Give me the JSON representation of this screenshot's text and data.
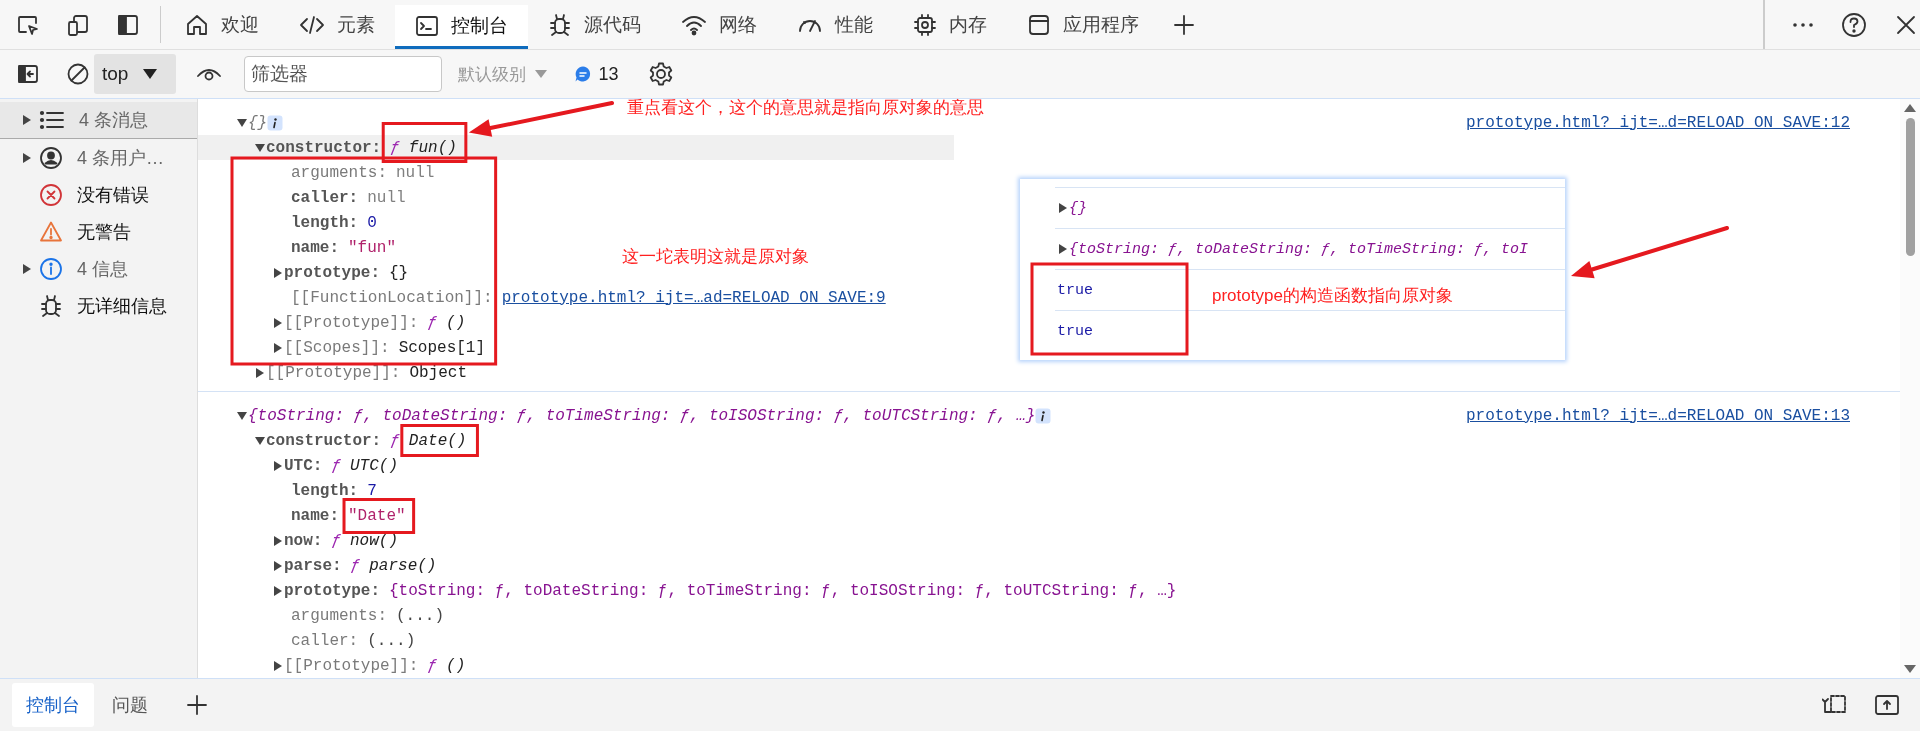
{
  "tabs": [
    {
      "label": "欢迎",
      "selected": false
    },
    {
      "label": "元素",
      "selected": false
    },
    {
      "label": "控制台",
      "selected": true
    },
    {
      "label": "源代码",
      "selected": false
    },
    {
      "label": "网络",
      "selected": false
    },
    {
      "label": "性能",
      "selected": false
    },
    {
      "label": "内存",
      "selected": false
    },
    {
      "label": "应用程序",
      "selected": false
    }
  ],
  "toolbar": {
    "context": "top",
    "filter": {
      "placeholder": "筛选器"
    },
    "levels": "默认级别",
    "message_count": "13"
  },
  "sidebar": {
    "items": [
      {
        "label": "4 条消息",
        "expandable": true,
        "muted": true,
        "selected": true
      },
      {
        "label": "4 条用户…",
        "expandable": true,
        "muted": true,
        "selected": false
      },
      {
        "label": "没有错误",
        "expandable": false,
        "muted": false,
        "selected": false
      },
      {
        "label": "无警告",
        "expandable": false,
        "muted": false,
        "selected": false
      },
      {
        "label": "4 信息",
        "expandable": true,
        "muted": true,
        "selected": false
      },
      {
        "label": "无详细信息",
        "expandable": false,
        "muted": false,
        "selected": false
      }
    ]
  },
  "console": {
    "messages": [
      {
        "summary": "{}",
        "expanded": true,
        "source": "prototype.html?_ijt=…d=RELOAD_ON_SAVE:12",
        "children": [
          {
            "key": "constructor:",
            "kind": "function",
            "mark": "ƒ",
            "value": "fun()",
            "expanded": true,
            "highlighted": true,
            "children": [
              {
                "key": "arguments:",
                "dim": true,
                "kind": "null",
                "value": "null"
              },
              {
                "key": "caller:",
                "dim": false,
                "kind": "null",
                "value": "null"
              },
              {
                "key": "length:",
                "dim": false,
                "kind": "number",
                "value": "0"
              },
              {
                "key": "name:",
                "dim": false,
                "kind": "string",
                "value": "\"fun\""
              },
              {
                "key": "prototype:",
                "dim": false,
                "kind": "object",
                "value": "{}",
                "expanded": false
              },
              {
                "key": "[[FunctionLocation]]:",
                "dim": true,
                "kind": "link",
                "value": "prototype.html?_ijt=…ad=RELOAD_ON_SAVE:9"
              },
              {
                "key": "[[Prototype]]:",
                "dim": true,
                "kind": "function",
                "mark": "ƒ",
                "value": "()",
                "expanded": false
              },
              {
                "key": "[[Scopes]]:",
                "dim": true,
                "kind": "object",
                "value": "Scopes[1]",
                "expanded": false
              }
            ]
          },
          {
            "key": "[[Prototype]]:",
            "dim": true,
            "kind": "object",
            "value": "Object",
            "expanded": false
          }
        ]
      },
      {
        "summary": "{toString: ƒ, toDateString: ƒ, toTimeString: ƒ, toISOString: ƒ, toUTCString: ƒ, …}",
        "expanded": true,
        "source": "prototype.html?_ijt=…d=RELOAD_ON_SAVE:13",
        "children": [
          {
            "key": "constructor:",
            "dim": false,
            "kind": "function",
            "mark": "ƒ",
            "value": "Date()",
            "expanded": true,
            "children": [
              {
                "key": "UTC:",
                "dim": false,
                "kind": "function",
                "mark": "ƒ",
                "value": "UTC()",
                "expanded": false
              },
              {
                "key": "length:",
                "dim": false,
                "kind": "number",
                "value": "7"
              },
              {
                "key": "name:",
                "dim": false,
                "kind": "string",
                "value": "\"Date\""
              },
              {
                "key": "now:",
                "dim": false,
                "kind": "function",
                "mark": "ƒ",
                "value": "now()",
                "expanded": false
              },
              {
                "key": "parse:",
                "dim": false,
                "kind": "function",
                "mark": "ƒ",
                "value": "parse()",
                "expanded": false
              },
              {
                "key": "prototype:",
                "dim": false,
                "kind": "preview",
                "value": "{toString: ƒ, toDateString: ƒ, toTimeString: ƒ, toISOString: ƒ, toUTCString: ƒ, …}",
                "expanded": false
              },
              {
                "key": "arguments:",
                "dim": true,
                "kind": "getter",
                "value": "(...)"
              },
              {
                "key": "caller:",
                "dim": true,
                "kind": "getter",
                "value": "(...)"
              },
              {
                "key": "[[Prototype]]:",
                "dim": true,
                "kind": "function",
                "mark": "ƒ",
                "value": "()",
                "expanded": false
              }
            ]
          }
        ]
      }
    ]
  },
  "overlay": {
    "rows": [
      {
        "kind": "object",
        "text": "{}",
        "expanded": false
      },
      {
        "kind": "object",
        "text": "{toString: ƒ, toDateString: ƒ, toTimeString: ƒ, toI",
        "expanded": false
      },
      {
        "kind": "boolean",
        "text": "true"
      },
      {
        "kind": "boolean",
        "text": "true"
      }
    ]
  },
  "annotations": [
    {
      "text": "重点看这个，这个的意思就是指向原对象的意思"
    },
    {
      "text": "这一坨表明这就是原对象"
    },
    {
      "text": "prototype的构造函数指向原对象"
    }
  ],
  "drawer": {
    "tabs": [
      {
        "label": "控制台",
        "selected": true
      },
      {
        "label": "问题",
        "selected": false
      }
    ]
  }
}
